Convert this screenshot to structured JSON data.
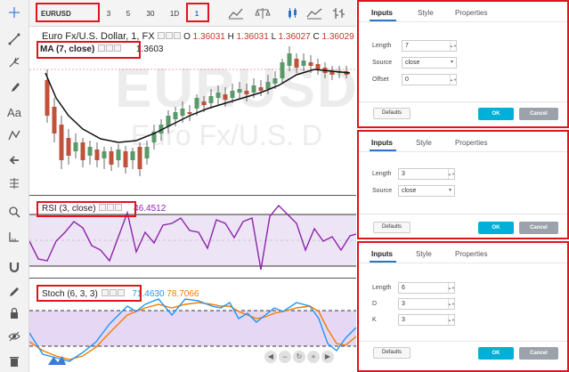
{
  "toolbar": {
    "symbol": "EURUSD",
    "intervals": [
      "3",
      "5",
      "30",
      "1D"
    ],
    "active_interval": "1"
  },
  "main_pane": {
    "legend": {
      "title": "Euro Fx/U.S. Dollar, 1, FX",
      "o_label": "O",
      "o_val": "1.36031",
      "h_label": "H",
      "h_val": "1.36031",
      "l_label": "L",
      "l_val": "1.36027",
      "c_label": "C",
      "c_val": "1.36029"
    },
    "ma_label": "MA (7, close)",
    "ma_value": "1.3603",
    "watermark_symbol": "EURUSD",
    "watermark_name": "Euro Fx/U.S. D"
  },
  "rsi_pane": {
    "label": "RSI (3, close)",
    "value": "46.4512"
  },
  "stoch_pane": {
    "label": "Stoch (6, 3, 3)",
    "value_k": "71.4630",
    "value_d": "78.7066"
  },
  "dialogs": [
    {
      "tabs": [
        "Inputs",
        "Style",
        "Properties"
      ],
      "fields": [
        {
          "label": "Length",
          "value": "7"
        },
        {
          "label": "Source",
          "value": "close"
        },
        {
          "label": "Offset",
          "value": "0"
        }
      ],
      "defaults": "Defaults",
      "ok": "OK",
      "cancel": "Cancel"
    },
    {
      "tabs": [
        "Inputs",
        "Style",
        "Properties"
      ],
      "fields": [
        {
          "label": "Length",
          "value": "3"
        },
        {
          "label": "Source",
          "value": "close"
        }
      ],
      "defaults": "Defaults",
      "ok": "OK",
      "cancel": "Cancel"
    },
    {
      "tabs": [
        "Inputs",
        "Style",
        "Properties"
      ],
      "fields": [
        {
          "label": "Length",
          "value": "6"
        },
        {
          "label": "D",
          "value": "3"
        },
        {
          "label": "K",
          "value": "3"
        }
      ],
      "defaults": "Defaults",
      "ok": "OK",
      "cancel": "Cancel"
    }
  ],
  "colors": {
    "accent": "#e0141e",
    "ok_button": "#00b0d8",
    "cancel_button": "#9ba2ab",
    "up_candle": "#5a9a6a",
    "down_candle": "#c0513a",
    "rsi_line": "#8e24aa",
    "stoch_k": "#2196f3",
    "stoch_d": "#f57c00"
  },
  "icons": [
    "crosshair-icon",
    "trend-line-icon",
    "pitchfork-icon",
    "brush-icon",
    "text-icon",
    "pattern-icon",
    "arrow-icon",
    "fib-icon",
    "zoom-icon",
    "measure-icon",
    "magnet-icon",
    "pencil-lock-icon",
    "lock-icon",
    "eye-icon",
    "trash-icon"
  ]
}
